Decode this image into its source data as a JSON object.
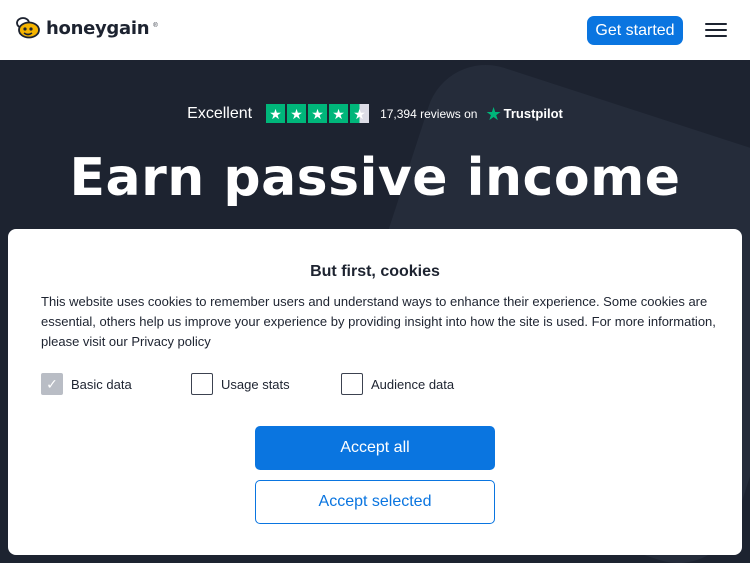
{
  "header": {
    "logo_text": "honeygain",
    "logo_mark": "®",
    "logo_icon": "bee-icon",
    "cta_label": "Get started",
    "menu_icon": "hamburger-menu-icon"
  },
  "hero": {
    "rating_label": "Excellent",
    "stars_filled": 4.5,
    "star_glyph": "★",
    "reviews_text": "17,394 reviews on",
    "trustpilot_label": "Trustpilot",
    "headline": "Earn passive income"
  },
  "cookies": {
    "title": "But first, cookies",
    "body": "This website uses cookies to remember users and understand ways to enhance their experience. Some cookies are essential, others help us improve your experience by providing insight into how the site is used. For more information, please visit our Privacy policy",
    "options": [
      {
        "label": "Basic data",
        "checked": true
      },
      {
        "label": "Usage stats",
        "checked": false
      },
      {
        "label": "Audience data",
        "checked": false
      }
    ],
    "accept_all_label": "Accept all",
    "accept_selected_label": "Accept selected"
  },
  "colors": {
    "brand_blue": "#0a75e0",
    "hero_bg": "#1d2330",
    "trustpilot_green": "#00b67a"
  }
}
